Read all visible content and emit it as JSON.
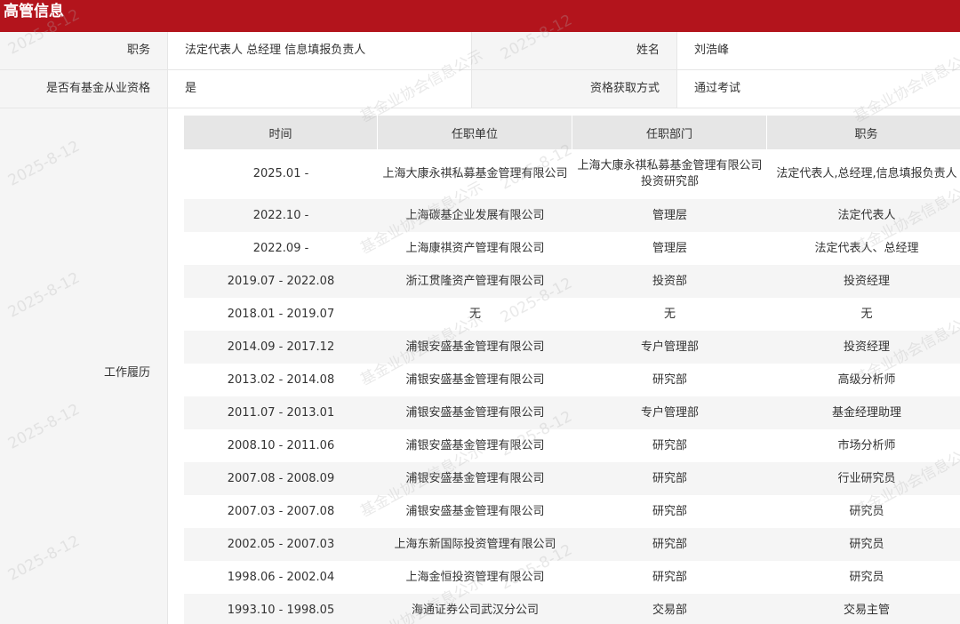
{
  "header": {
    "title": "高管信息"
  },
  "info": {
    "row1": {
      "label1": "职务",
      "value1": "法定代表人 总经理 信息填报负责人",
      "label2": "姓名",
      "value2": "刘浩峰"
    },
    "row2": {
      "label1": "是否有基金从业资格",
      "value1": "是",
      "label2": "资格获取方式",
      "value2": "通过考试"
    }
  },
  "work": {
    "label": "工作履历",
    "columns": [
      "时间",
      "任职单位",
      "任职部门",
      "职务"
    ],
    "rows": [
      [
        "2025.01 -",
        "上海大康永祺私募基金管理有限公司",
        "上海大康永祺私募基金管理有限公司投资研究部",
        "法定代表人,总经理,信息填报负责人"
      ],
      [
        "2022.10 -",
        "上海碳基企业发展有限公司",
        "管理层",
        "法定代表人"
      ],
      [
        "2022.09 -",
        "上海康祺资产管理有限公司",
        "管理层",
        "法定代表人、总经理"
      ],
      [
        "2019.07 - 2022.08",
        "浙江贯隆资产管理有限公司",
        "投资部",
        "投资经理"
      ],
      [
        "2018.01 - 2019.07",
        "无",
        "无",
        "无"
      ],
      [
        "2014.09 - 2017.12",
        "浦银安盛基金管理有限公司",
        "专户管理部",
        "投资经理"
      ],
      [
        "2013.02 - 2014.08",
        "浦银安盛基金管理有限公司",
        "研究部",
        "高级分析师"
      ],
      [
        "2011.07 - 2013.01",
        "浦银安盛基金管理有限公司",
        "专户管理部",
        "基金经理助理"
      ],
      [
        "2008.10 - 2011.06",
        "浦银安盛基金管理有限公司",
        "研究部",
        "市场分析师"
      ],
      [
        "2007.08 - 2008.09",
        "浦银安盛基金管理有限公司",
        "研究部",
        "行业研究员"
      ],
      [
        "2007.03 - 2007.08",
        "浦银安盛基金管理有限公司",
        "研究部",
        "研究员"
      ],
      [
        "2002.05 - 2007.03",
        "上海东新国际投资管理有限公司",
        "研究部",
        "研究员"
      ],
      [
        "1998.06 - 2002.04",
        "上海金恒投资管理有限公司",
        "研究部",
        "研究员"
      ],
      [
        "1993.10 - 1998.05",
        "海通证券公司武汉分公司",
        "交易部",
        "交易主管"
      ]
    ]
  },
  "watermarks": {
    "date": "2025-8-12",
    "org": "基金业协会信息公示"
  },
  "colors": {
    "header_bg": "#b3141c",
    "label_bg": "#f5f5f5",
    "table_header_bg": "#e6e6e6",
    "alt_row_bg": "#f5f5f5"
  }
}
